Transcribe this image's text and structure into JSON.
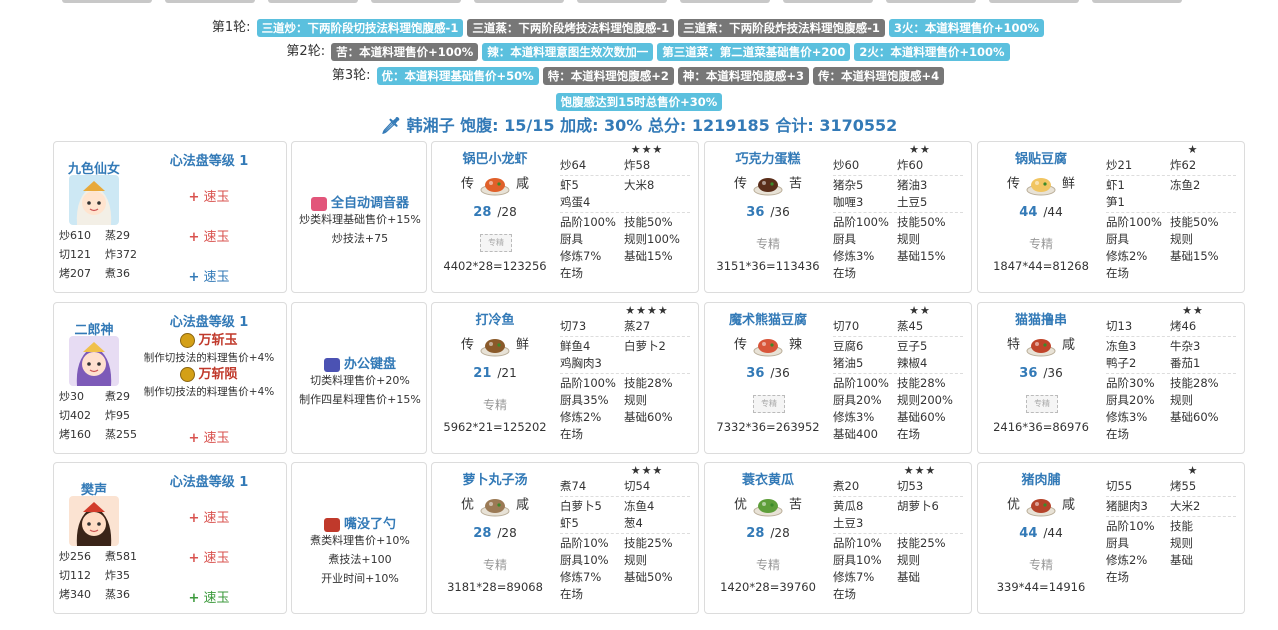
{
  "rounds": [
    {
      "label": "第1轮:",
      "tags": [
        {
          "text": "三道炒：下两阶段切技法料理饱腹感-1",
          "color": "blue"
        },
        {
          "text": "三道蒸：下两阶段烤技法料理饱腹感-1",
          "color": "gray"
        },
        {
          "text": "三道煮：下两阶段炸技法料理饱腹感-1",
          "color": "gray"
        },
        {
          "text": "3火：本道料理售价+100%",
          "color": "blue"
        }
      ]
    },
    {
      "label": "第2轮:",
      "tags": [
        {
          "text": "苦：本道料理售价+100%",
          "color": "gray"
        },
        {
          "text": "辣：本道料理意图生效次数加一",
          "color": "blue"
        },
        {
          "text": "第三道菜：第二道菜基础售价+200",
          "color": "blue"
        },
        {
          "text": "2火：本道料理售价+100%",
          "color": "blue"
        }
      ]
    },
    {
      "label": "第3轮:",
      "tags": [
        {
          "text": "优：本道料理基础售价+50%",
          "color": "blue"
        },
        {
          "text": "特：本道料理饱腹感+2",
          "color": "gray"
        },
        {
          "text": "神：本道料理饱腹感+3",
          "color": "gray"
        },
        {
          "text": "传：本道料理饱腹感+4",
          "color": "gray"
        }
      ]
    },
    {
      "label": "",
      "tags": [
        {
          "text": "饱腹感达到15时总售价+30%",
          "color": "blue"
        }
      ]
    }
  ],
  "summary": "🗡 韩湘子 饱腹: 15/15 加成: 30% 总分: 1219185 合计: 3170552",
  "rows": [
    {
      "chef": {
        "name": "九色仙女",
        "avatar": "fairy",
        "skills": [
          [
            "炒610",
            "蒸29"
          ],
          [
            "切121",
            "炸372"
          ],
          [
            "烤207",
            "煮36"
          ]
        ],
        "level": "心法盘等级 1",
        "ambers": [
          {
            "plus": "+",
            "text": "速玉",
            "color": "red"
          },
          {
            "plus": "+",
            "text": "速玉",
            "color": "red"
          },
          {
            "plus": "+",
            "text": "速玉",
            "color": "blue"
          }
        ]
      },
      "equip": {
        "name": "全自动调音器",
        "icon": "tuner-icon",
        "desc": [
          "炒类料理基础售价+15%",
          "炒技法+75"
        ]
      },
      "recipes": [
        {
          "name": "锅巴小龙虾",
          "stars": "★★★",
          "grade": "传",
          "taste": "咸",
          "qty": "28",
          "max": "/28",
          "spec": "专精",
          "specStyle": "dashed",
          "score": "4402*28=123256",
          "dish": "shrimp",
          "skills": [
            [
              "炒64",
              "炸58"
            ]
          ],
          "ingredients": [
            [
              "虾5",
              "大米8"
            ],
            [
              "鸡蛋4",
              ""
            ]
          ],
          "stats": [
            [
              "品阶100%",
              "技能50%"
            ],
            [
              "厨具",
              "规则100%"
            ],
            [
              "修炼7%",
              "基础15%"
            ],
            [
              "在场",
              ""
            ]
          ]
        },
        {
          "name": "巧克力蛋糕",
          "stars": "★★",
          "grade": "传",
          "taste": "苦",
          "qty": "36",
          "max": "/36",
          "spec": "专精",
          "specStyle": "text",
          "score": "3151*36=113436",
          "dish": "cake",
          "skills": [
            [
              "炒60",
              "炸60"
            ]
          ],
          "ingredients": [
            [
              "猪杂5",
              "猪油3"
            ],
            [
              "咖喱3",
              "土豆5"
            ]
          ],
          "stats": [
            [
              "品阶100%",
              "技能50%"
            ],
            [
              "厨具",
              "规则"
            ],
            [
              "修炼3%",
              "基础15%"
            ],
            [
              "在场",
              ""
            ]
          ]
        },
        {
          "name": "锅贴豆腐",
          "stars": "★",
          "grade": "传",
          "taste": "鲜",
          "qty": "44",
          "max": "/44",
          "spec": "专精",
          "specStyle": "text",
          "score": "1847*44=81268",
          "dish": "tofu",
          "skills": [
            [
              "炒21",
              "炸62"
            ]
          ],
          "ingredients": [
            [
              "虾1",
              "冻鱼2"
            ],
            [
              "笋1",
              ""
            ]
          ],
          "stats": [
            [
              "品阶100%",
              "技能50%"
            ],
            [
              "厨具",
              "规则"
            ],
            [
              "修炼2%",
              "基础15%"
            ],
            [
              "在场",
              ""
            ]
          ]
        }
      ]
    },
    {
      "chef": {
        "name": "二郎神",
        "avatar": "erlang",
        "skills": [
          [
            "炒30",
            "煮29"
          ],
          [
            "切402",
            "炸95"
          ],
          [
            "烤160",
            "蒸255"
          ]
        ],
        "level": "心法盘等级 1",
        "named": [
          {
            "name": "万斩玉",
            "desc": "制作切技法的料理售价+4%"
          },
          {
            "name": "万斩陨",
            "desc": "制作切技法的料理售价+4%"
          }
        ],
        "ambers": [
          {
            "plus": "+",
            "text": "速玉",
            "color": "red"
          }
        ]
      },
      "equip": {
        "name": "办公键盘",
        "icon": "keyboard-icon",
        "desc": [
          "切类料理售价+20%",
          "制作四星料理售价+15%"
        ]
      },
      "recipes": [
        {
          "name": "打冷鱼",
          "stars": "★★★★",
          "grade": "传",
          "taste": "鲜",
          "qty": "21",
          "max": "/21",
          "spec": "专精",
          "specStyle": "text",
          "score": "5962*21=125202",
          "dish": "fish",
          "skills": [
            [
              "切73",
              "蒸27"
            ]
          ],
          "ingredients": [
            [
              "鲜鱼4",
              "白萝卜2"
            ],
            [
              "鸡胸肉3",
              ""
            ]
          ],
          "stats": [
            [
              "品阶100%",
              "技能28%"
            ],
            [
              "厨具35%",
              "规则"
            ],
            [
              "修炼2%",
              "基础60%"
            ],
            [
              "在场",
              ""
            ]
          ]
        },
        {
          "name": "魔术熊猫豆腐",
          "stars": "★★",
          "grade": "传",
          "taste": "辣",
          "qty": "36",
          "max": "/36",
          "spec": "专精",
          "specStyle": "dashed",
          "score": "7332*36=263952",
          "dish": "panda",
          "skills": [
            [
              "切70",
              "蒸45"
            ]
          ],
          "ingredients": [
            [
              "豆腐6",
              "豆子5"
            ],
            [
              "猪油5",
              "辣椒4"
            ]
          ],
          "stats": [
            [
              "品阶100%",
              "技能28%"
            ],
            [
              "厨具20%",
              "规则200%"
            ],
            [
              "修炼3%",
              "基础60%"
            ],
            [
              "基础400",
              "在场"
            ]
          ]
        },
        {
          "name": "猫猫撸串",
          "stars": "★★",
          "grade": "特",
          "taste": "咸",
          "qty": "36",
          "max": "/36",
          "spec": "专精",
          "specStyle": "dashed",
          "score": "2416*36=86976",
          "dish": "skewer",
          "skills": [
            [
              "切13",
              "烤46"
            ]
          ],
          "ingredients": [
            [
              "冻鱼3",
              "牛杂3"
            ],
            [
              "鸭子2",
              "番茄1"
            ]
          ],
          "stats": [
            [
              "品阶30%",
              "技能28%"
            ],
            [
              "厨具20%",
              "规则"
            ],
            [
              "修炼3%",
              "基础60%"
            ],
            [
              "在场",
              ""
            ]
          ]
        }
      ]
    },
    {
      "chef": {
        "name": "樊声",
        "avatar": "fansheng",
        "skills": [
          [
            "炒256",
            "煮581"
          ],
          [
            "切112",
            "炸35"
          ],
          [
            "烤340",
            "蒸36"
          ]
        ],
        "level": "心法盘等级 1",
        "ambers": [
          {
            "plus": "+",
            "text": "速玉",
            "color": "red"
          },
          {
            "plus": "+",
            "text": "速玉",
            "color": "red"
          },
          {
            "plus": "+",
            "text": "速玉",
            "color": "green"
          }
        ]
      },
      "equip": {
        "name": "嘴没了勺",
        "icon": "spoon-icon",
        "desc": [
          "煮类料理售价+10%",
          "煮技法+100",
          "开业时间+10%"
        ]
      },
      "recipes": [
        {
          "name": "萝卜丸子汤",
          "stars": "★★★",
          "grade": "优",
          "taste": "咸",
          "qty": "28",
          "max": "/28",
          "spec": "专精",
          "specStyle": "text",
          "score": "3181*28=89068",
          "dish": "soup",
          "skills": [
            [
              "煮74",
              "切54"
            ]
          ],
          "ingredients": [
            [
              "白萝卜5",
              "冻鱼4"
            ],
            [
              "虾5",
              "葱4"
            ]
          ],
          "stats": [
            [
              "品阶10%",
              "技能25%"
            ],
            [
              "厨具10%",
              "规则"
            ],
            [
              "修炼7%",
              "基础50%"
            ],
            [
              "在场",
              ""
            ]
          ]
        },
        {
          "name": "蓑衣黄瓜",
          "stars": "★★★",
          "grade": "优",
          "taste": "苦",
          "qty": "28",
          "max": "/28",
          "spec": "专精",
          "specStyle": "text",
          "score": "1420*28=39760",
          "dish": "cucumber",
          "skills": [
            [
              "煮20",
              "切53"
            ]
          ],
          "ingredients": [
            [
              "黄瓜8",
              "胡萝卜6"
            ],
            [
              "土豆3",
              ""
            ]
          ],
          "stats": [
            [
              "品阶10%",
              "技能25%"
            ],
            [
              "厨具10%",
              "规则"
            ],
            [
              "修炼7%",
              "基础"
            ],
            [
              "在场",
              ""
            ]
          ]
        },
        {
          "name": "猪肉脯",
          "stars": "★",
          "grade": "优",
          "taste": "咸",
          "qty": "44",
          "max": "/44",
          "spec": "专精",
          "specStyle": "text",
          "score": "339*44=14916",
          "dish": "pork",
          "skills": [
            [
              "切55",
              "烤55"
            ]
          ],
          "ingredients": [
            [
              "猪腿肉3",
              "大米2"
            ]
          ],
          "stats": [
            [
              "品阶10%",
              "技能"
            ],
            [
              "厨具",
              "规则"
            ],
            [
              "修炼2%",
              "基础"
            ],
            [
              "在场",
              ""
            ]
          ]
        }
      ]
    }
  ]
}
